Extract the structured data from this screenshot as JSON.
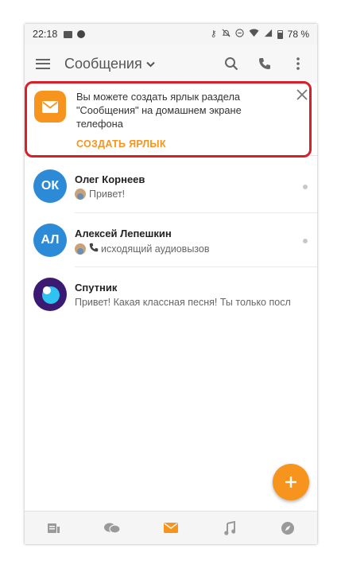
{
  "statusbar": {
    "time": "22:18",
    "battery": "78 %"
  },
  "header": {
    "title": "Сообщения"
  },
  "banner": {
    "text": "Вы можете создать ярлык раздела \"Сообщения\" на домашнем экране телефона",
    "action": "СОЗДАТЬ ЯРЛЫК"
  },
  "chats": [
    {
      "initials": "ОК",
      "name": "Олег Корнеев",
      "preview": "Привет!",
      "avatar_color": "#2d8ad6"
    },
    {
      "initials": "АЛ",
      "name": "Алексей Лепешкин",
      "preview": "исходящий аудиовызов",
      "avatar_color": "#2d8ad6"
    },
    {
      "name": "Спутник",
      "preview": "Привет! Какая классная песня! Ты только посл",
      "avatar_color": "#3b1a73"
    }
  ],
  "colors": {
    "accent": "#f7941d",
    "highlight": "#d9202a"
  },
  "icons": {
    "nav": [
      "feed-icon",
      "discussions-icon",
      "messages-icon",
      "music-icon",
      "compass-icon"
    ]
  }
}
